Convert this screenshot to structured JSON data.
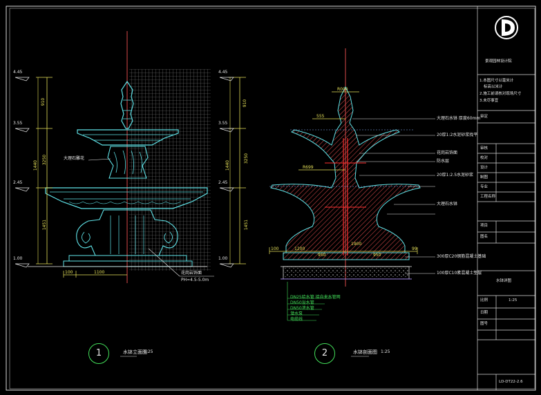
{
  "colors": {
    "background": "#000000",
    "frame": "#e8e8e8",
    "outline_cyan": "#5fe3e8",
    "hatch_red": "#e05050",
    "grid_white": "#bbbbbb",
    "dimension_yellow": "#e8e35a",
    "note_green": "#43e05a"
  },
  "views": [
    {
      "number": "1",
      "title": "水钵立面图",
      "scale": "1:25",
      "elevations": [
        "4.45",
        "3.55",
        "2.45",
        "1.00"
      ],
      "heights": [
        "910",
        "1440",
        "3250",
        "1451"
      ],
      "widths": [
        "100",
        "1100"
      ],
      "notes": [
        "大理石雕花",
        "花岗岩饰面",
        "PH=4.5-5.0m"
      ]
    },
    {
      "number": "2",
      "title": "水钵剖面图",
      "scale": "1:25",
      "elevations": [
        "4.45",
        "3.55",
        "2.45",
        "1.00"
      ],
      "heights": [
        "910",
        "1440",
        "3250",
        "1451"
      ],
      "widths": [
        "100",
        "1200",
        "1900",
        "950",
        "950",
        "99"
      ],
      "radii": [
        "555",
        "R699",
        "R000"
      ],
      "notes": [
        "大理石水钵 厚度60mm",
        "20厚1:2水泥砂浆找平",
        "花岗岩饰面",
        "防水层",
        "20厚1:2.5水泥砂浆",
        "大理石水钵",
        "300厚C20钢筋混凝土基础",
        "100厚C10素混凝土垫层"
      ],
      "pipe_notes": [
        "DN25给水管 接自来水管网",
        "DN50溢水管",
        "DN50泄水管",
        "潜水泵",
        "电缆线"
      ]
    }
  ],
  "title_block": {
    "company": "景观园林设计院",
    "header_notes": [
      "1.本图尺寸以毫米计",
      "标高以米计",
      "2.施工前请核对现场尺寸",
      "3.未尽事宜"
    ],
    "rows": [
      "审定",
      "审核",
      "校对",
      "设计",
      "制图",
      "专业",
      "工程名称",
      "项目",
      "图名",
      "水钵详图",
      "比例",
      "日期",
      "图号"
    ],
    "values": [
      "",
      "",
      "",
      "",
      "",
      "",
      "",
      "",
      "",
      "",
      "1:25",
      "",
      ""
    ],
    "drawing_name": "水钵详图",
    "drawing_number": "LD-DT22-2.6"
  }
}
